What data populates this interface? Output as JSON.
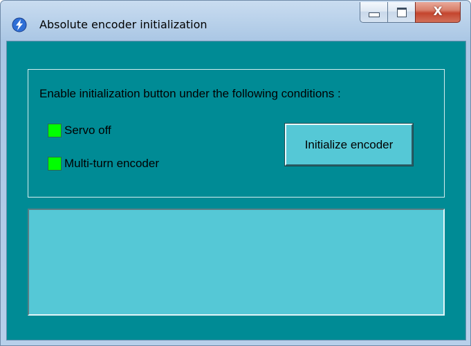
{
  "window": {
    "title": "Absolute encoder initialization",
    "app_icon": "lightning-bolt-icon",
    "controls": {
      "minimize_icon": "minimize-icon",
      "maximize_icon": "maximize-icon",
      "close_icon": "close-icon",
      "close_glyph": "X"
    }
  },
  "conditions": {
    "heading": "Enable initialization button under the following conditions :",
    "items": [
      {
        "label": "Servo off",
        "status_color": "#00ff00"
      },
      {
        "label": "Multi-turn encoder",
        "status_color": "#00ff00"
      }
    ]
  },
  "actions": {
    "initialize_label": "Initialize encoder"
  },
  "output": {
    "text": ""
  },
  "colors": {
    "client_background": "#008b95",
    "button_face": "#55c8d6",
    "indicator_on": "#00ff00"
  }
}
